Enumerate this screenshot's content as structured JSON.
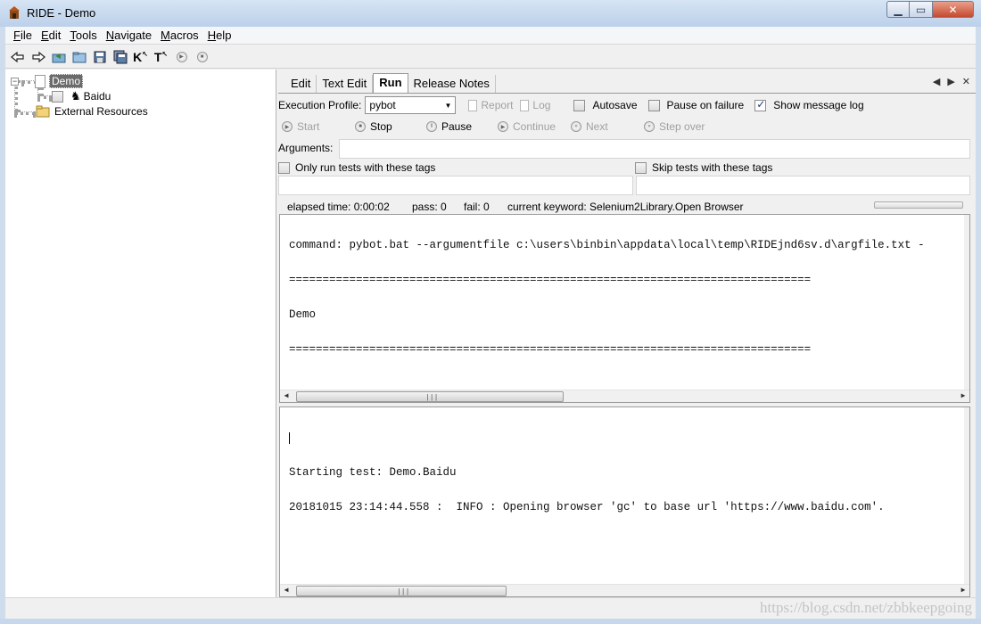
{
  "window": {
    "title": "RIDE - Demo",
    "app_icon": "ride-app-icon"
  },
  "menubar": [
    {
      "label": "File",
      "u": "F",
      "rest": "ile"
    },
    {
      "label": "Edit",
      "u": "E",
      "rest": "dit"
    },
    {
      "label": "Tools",
      "u": "T",
      "rest": "ools"
    },
    {
      "label": "Navigate",
      "u": "N",
      "rest": "avigate"
    },
    {
      "label": "Macros",
      "u": "M",
      "rest": "acros"
    },
    {
      "label": "Help",
      "u": "H",
      "rest": "elp"
    }
  ],
  "toolbar": {
    "icons": [
      "back-arrow-icon",
      "forward-arrow-icon",
      "open-test-suite-icon",
      "open-directory-icon",
      "save-icon",
      "save-all-icon",
      "search-keywords-icon",
      "search-tests-icon",
      "run-icon",
      "stop-icon"
    ],
    "k_label": "K",
    "t_label": "T"
  },
  "tree": {
    "root": {
      "label": "Demo",
      "expander": "−"
    },
    "child": {
      "label": "Baidu"
    },
    "resources": {
      "label": "External Resources"
    }
  },
  "tabs": [
    {
      "label": "Edit"
    },
    {
      "label": "Text Edit"
    },
    {
      "label": "Run",
      "active": true
    },
    {
      "label": "Release Notes"
    }
  ],
  "tab_nav": {
    "prev": "◀",
    "next": "▶",
    "close": "✕"
  },
  "run": {
    "execution_profile_label": "Execution Profile:",
    "execution_profile_value": "pybot",
    "report_label": "Report",
    "log_label": "Log",
    "autosave_label": "Autosave",
    "pause_on_failure_label": "Pause on failure",
    "show_message_log_label": "Show message log",
    "show_message_log_checked": true,
    "start_label": "Start",
    "stop_label": "Stop",
    "pause_label": "Pause",
    "continue_label": "Continue",
    "next_label": "Next",
    "step_over_label": "Step over",
    "arguments_label": "Arguments:",
    "arguments_value": "",
    "only_run_tags_label": "Only run tests with these tags",
    "skip_tags_label": "Skip tests with these tags",
    "elapsed": "elapsed time: 0:00:02",
    "pass": "pass: 0",
    "fail": "fail: 0",
    "current_keyword": "current keyword: Selenium2Library.Open Browser"
  },
  "output_console": {
    "lines": [
      "command: pybot.bat --argumentfile c:\\users\\binbin\\appdata\\local\\temp\\RIDEjnd6sv.d\\argfile.txt -",
      "==============================================================================",
      "Demo",
      "=============================================================================="
    ]
  },
  "message_log": {
    "lines": [
      "",
      "Starting test: Demo.Baidu",
      "20181015 23:14:44.558 :  INFO : Opening browser 'gc' to base url 'https://www.baidu.com'."
    ]
  },
  "watermark": "https://blog.csdn.net/zbbkeepgoing"
}
